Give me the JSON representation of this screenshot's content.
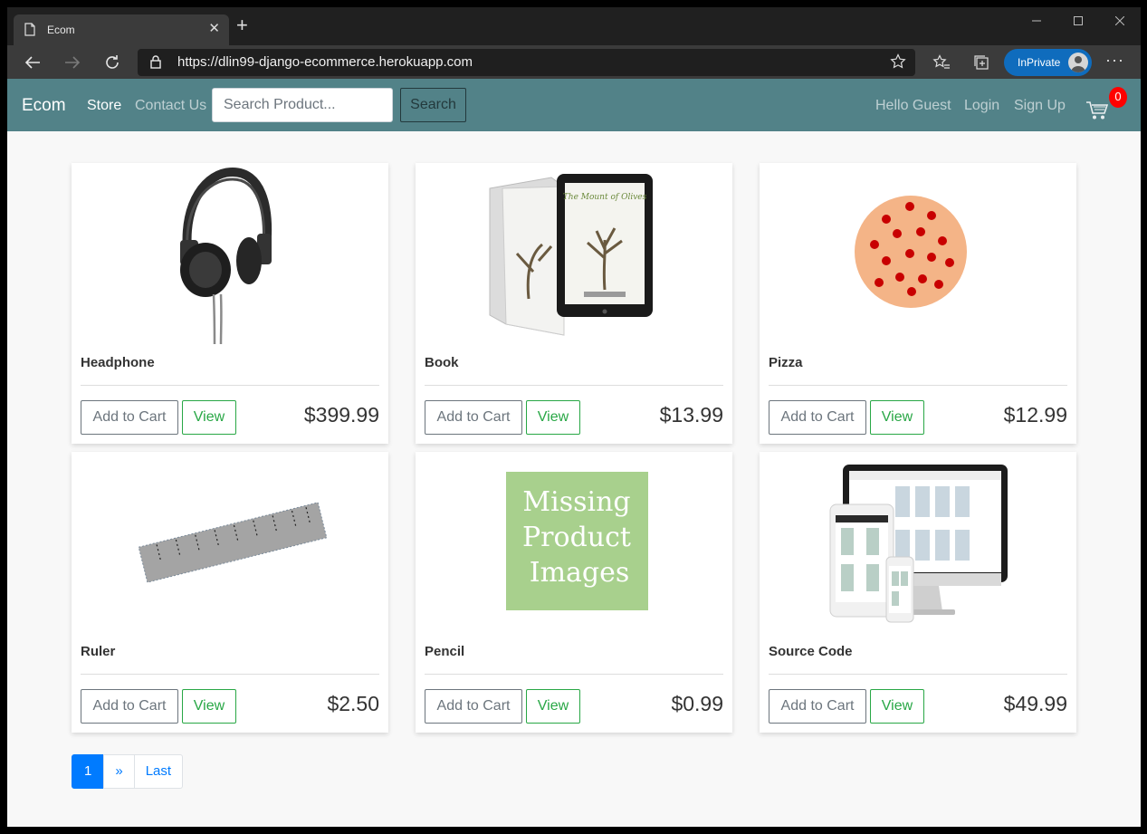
{
  "browser": {
    "tab_title": "Ecom",
    "url": "https://dlin99-django-ecommerce.herokuapp.com",
    "inprivate_label": "InPrivate"
  },
  "navbar": {
    "brand": "Ecom",
    "links": [
      "Store",
      "Contact Us"
    ],
    "search_placeholder": "Search Product...",
    "search_button": "Search",
    "greeting": "Hello Guest",
    "login": "Login",
    "signup": "Sign Up",
    "cart_count": "0"
  },
  "products": [
    {
      "name": "Headphone",
      "price": "$399.99",
      "add_label": "Add to Cart",
      "view_label": "View"
    },
    {
      "name": "Book",
      "price": "$13.99",
      "add_label": "Add to Cart",
      "view_label": "View"
    },
    {
      "name": "Pizza",
      "price": "$12.99",
      "add_label": "Add to Cart",
      "view_label": "View"
    },
    {
      "name": "Ruler",
      "price": "$2.50",
      "add_label": "Add to Cart",
      "view_label": "View"
    },
    {
      "name": "Pencil",
      "price": "$0.99",
      "add_label": "Add to Cart",
      "view_label": "View",
      "placeholder_image_text": [
        "Missing",
        "Product",
        "Images"
      ]
    },
    {
      "name": "Source Code",
      "price": "$49.99",
      "add_label": "Add to Cart",
      "view_label": "View"
    }
  ],
  "pagination": {
    "current": "1",
    "next": "»",
    "last": "Last"
  },
  "colors": {
    "navbar": "#528288",
    "primary": "#007bff",
    "view_button": "#28a745",
    "cart_badge": "#ff0000"
  }
}
